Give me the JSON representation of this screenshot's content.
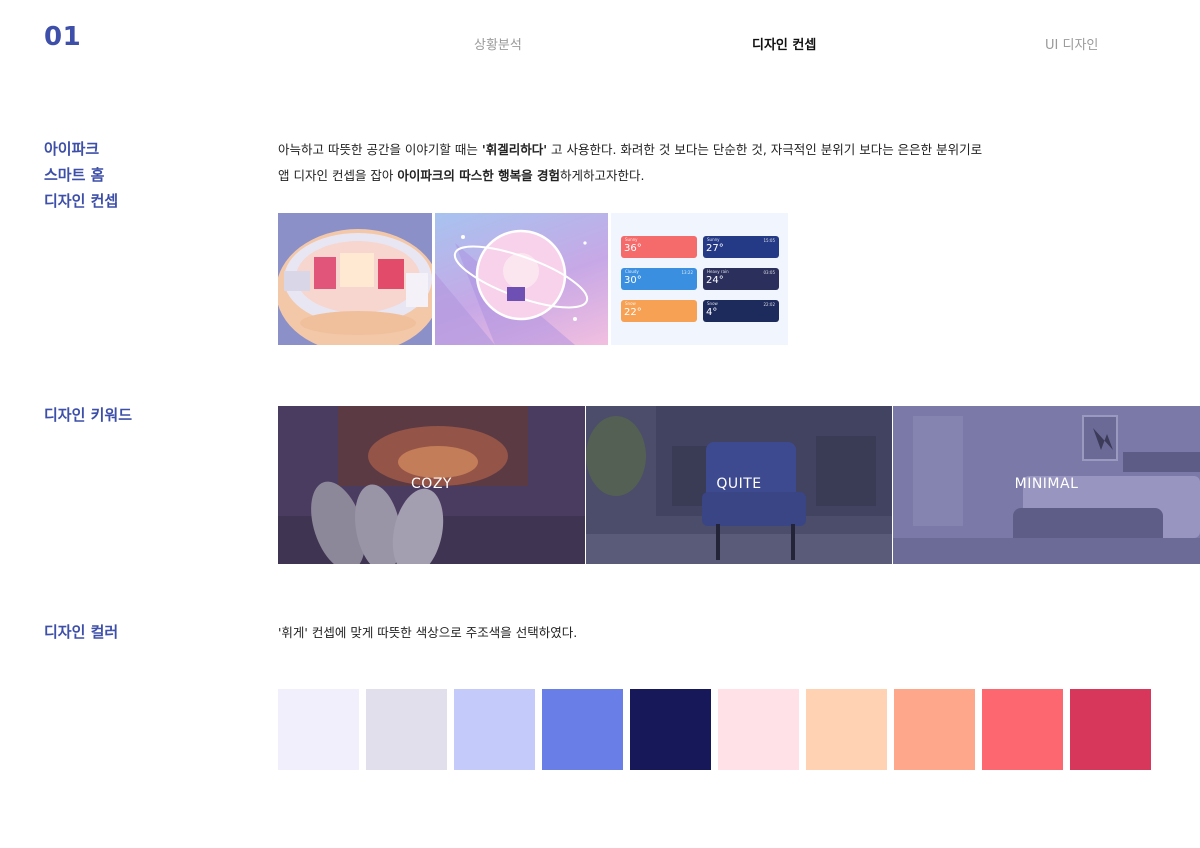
{
  "header": {
    "page_number": "01",
    "nav": [
      "상황분석",
      "디자인 컨셉",
      "UI 디자인"
    ],
    "active_index": 1
  },
  "concept": {
    "title_lines": [
      "아이파크",
      "스마트 홈",
      "디자인 컨셉"
    ],
    "desc_line1_pre": "아늑하고 따뜻한 공간을 이야기할 때는 ",
    "desc_line1_bold": "'휘겔리하다'",
    "desc_line1_post": " 고 사용한다. 화려한 것 보다는 단순한 것, 자극적인 분위기 보다는 은은한 분위기로",
    "desc_line2_pre": "앱 디자인 컨셉을 잡아 ",
    "desc_line2_bold": "아이파크의 따스한 행복을 경험",
    "desc_line2_post": "하게하고자한다."
  },
  "weather_cards": [
    {
      "status": "Sunny",
      "temp": "36°",
      "time": "",
      "bg": "#f56a6a"
    },
    {
      "status": "Sunny",
      "temp": "27°",
      "time": "15:05",
      "bg": "#243a86"
    },
    {
      "status": "Cloudy",
      "temp": "30°",
      "time": "13:22",
      "bg": "#3a8fe0"
    },
    {
      "status": "Heavy rain",
      "temp": "24°",
      "time": "03:05",
      "bg": "#2a2f5c"
    },
    {
      "status": "Snow",
      "temp": "22°",
      "time": "",
      "bg": "#f7a155"
    },
    {
      "status": "Snow",
      "temp": "4°",
      "time": "22:02",
      "bg": "#1d2a5c"
    }
  ],
  "keywords": {
    "title": "디자인 키워드",
    "items": [
      "COZY",
      "QUITE",
      "MINIMAL"
    ]
  },
  "colors": {
    "title": "디자인 컬러",
    "desc": "'휘게' 컨셉에 맞게 따뜻한 색상으로 주조색을 선택하였다.",
    "swatches": [
      "#f1effc",
      "#e0dfeb",
      "#c4cafa",
      "#6a7ee8",
      "#17185a",
      "#ffe1e7",
      "#ffd2b4",
      "#ffa78a",
      "#fd6870",
      "#d6375a"
    ]
  }
}
